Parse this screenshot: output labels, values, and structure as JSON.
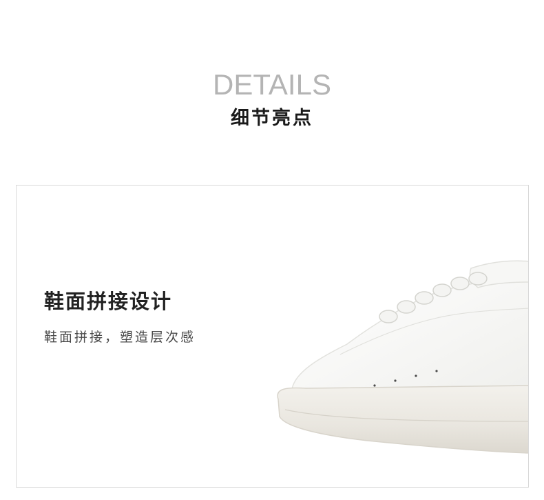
{
  "header": {
    "title_en": "DETAILS",
    "title_cn": "细节亮点"
  },
  "feature": {
    "title": "鞋面拼接设计",
    "description": "鞋面拼接，塑造层次感"
  },
  "colors": {
    "header_en": "#b4b4b4",
    "header_cn": "#1a1a1a",
    "panel_border": "#d9d9d9",
    "text_dark": "#222222",
    "text_body": "#4a4a4a"
  },
  "icons": {
    "product": "white-sneaker-image"
  }
}
